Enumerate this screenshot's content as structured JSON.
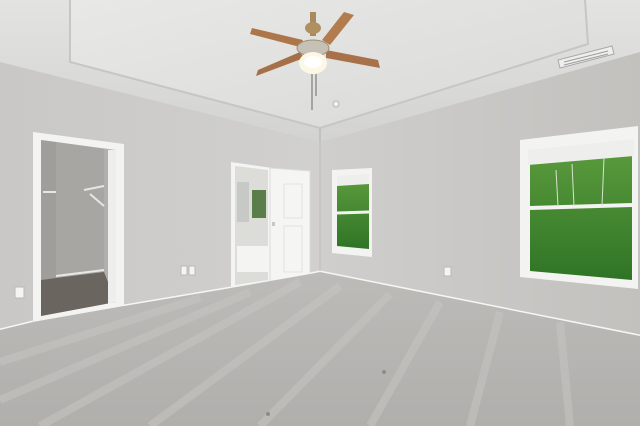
{
  "scene": {
    "kind": "interior-photo",
    "room": "empty bedroom",
    "features": [
      "ceiling-fan",
      "tray-ceiling",
      "walk-in-closet",
      "bathroom-doorway",
      "window-left",
      "window-right",
      "carpet-floor",
      "air-vent",
      "wall-outlets"
    ],
    "colors": {
      "wall": "#c9c8c5",
      "ceiling": "#dcdcdb",
      "trim": "#f3f3f1",
      "carpet": "#b8b6b3",
      "fan_blade": "#b07a4f",
      "foliage": "#3f8a2e"
    }
  }
}
